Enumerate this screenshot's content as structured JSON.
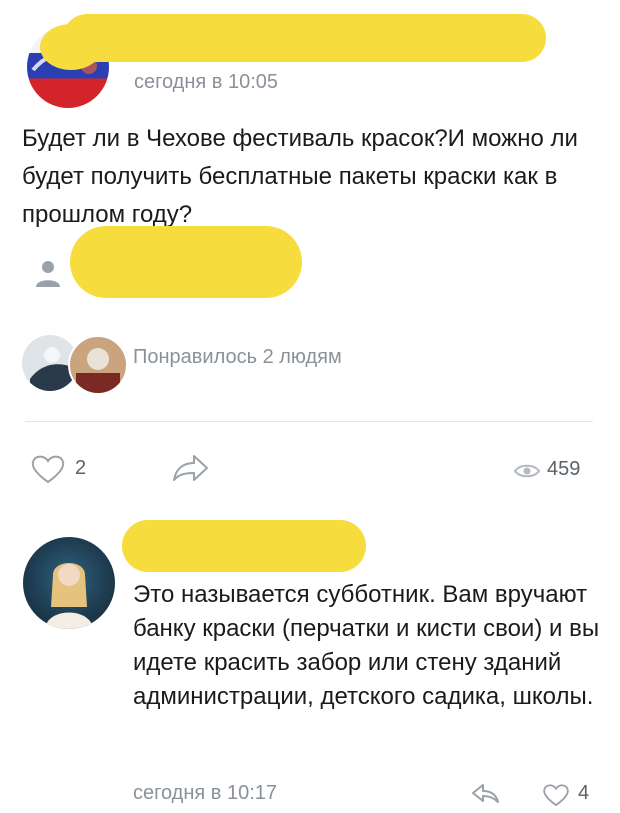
{
  "post": {
    "time": "сегодня в 10:05",
    "text": "Будет ли в Чехове фестиваль красок?И можно ли будет получить бесплатные пакеты краски как в прошлом году?",
    "likes_text": "Понравилось 2 людям"
  },
  "actions": {
    "like_count": "2",
    "views_count": "459"
  },
  "comment": {
    "text": "Это называется субботник. Вам вручают банку краски (перчатки и кисти свои) и вы идете красить забор или стену зданий администрации, детского садика, школы.",
    "time": "сегодня в 10:17",
    "like_count": "4"
  },
  "colors": {
    "redaction": "#f7dc3e",
    "muted_text": "#8a9199",
    "icon_gray": "#9aa1a8"
  },
  "icons": [
    "heart-icon",
    "share-icon",
    "eye-icon",
    "reply-icon",
    "user-icon"
  ]
}
